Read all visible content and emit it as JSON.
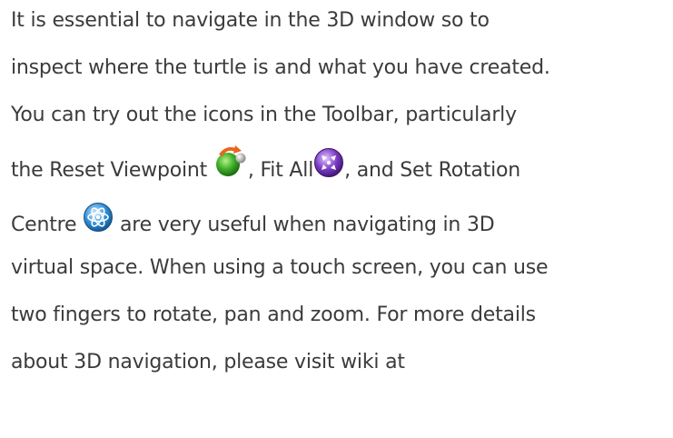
{
  "paragraph": {
    "line1": "It is essential to navigate in the 3D window so to",
    "line2": "inspect where the turtle is and what you have created.",
    "line3": "You can try out the icons in the Toolbar, particularly",
    "line4_before": "the Reset Viewpoint ",
    "line4_mid": ",  Fit All",
    "line4_after": ", and Set Rotation",
    "line5_before": "Centre ",
    "line5_after": " are very useful when navigating in 3D",
    "line6": "virtual space. When using a touch screen, you can use",
    "line7": "two fingers to rotate, pan and zoom. For more details",
    "line8": "about 3D navigation, please visit wiki at"
  },
  "icons": {
    "reset_viewpoint": "reset-viewpoint-icon",
    "fit_all": "fit-all-icon",
    "set_rotation_centre": "set-rotation-centre-icon"
  },
  "colors": {
    "text": "#3b3b3b",
    "reset_icon_green": "#3fae2a",
    "reset_icon_orange": "#e8661c",
    "fit_all_purple": "#7b3bc4",
    "rotation_centre_blue": "#2f8fd8"
  }
}
